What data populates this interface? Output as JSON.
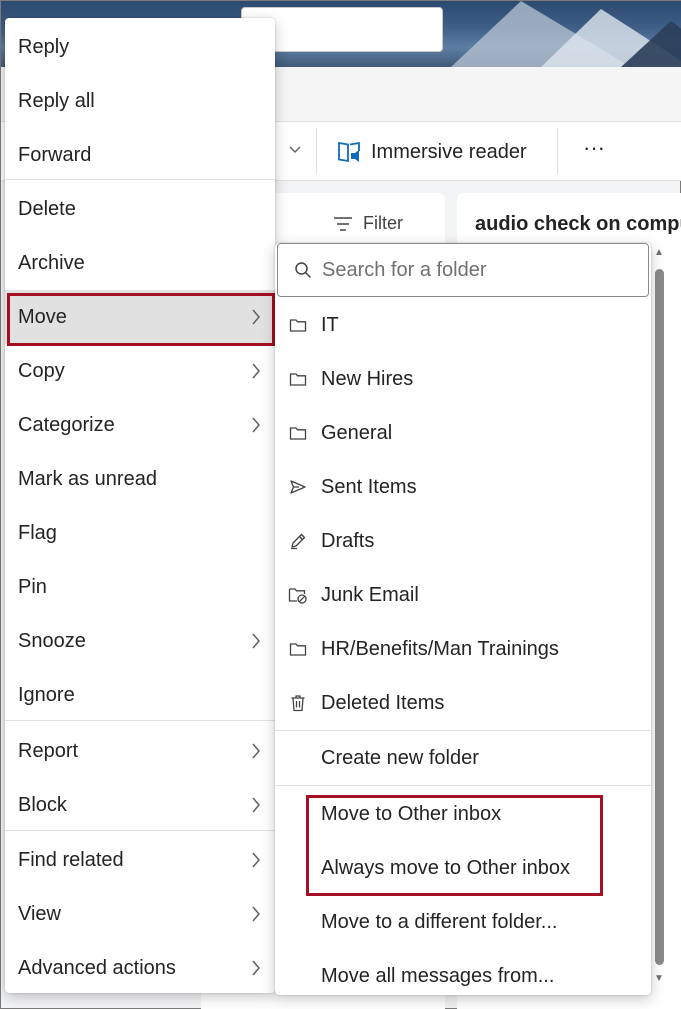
{
  "toolbar": {
    "immersive_reader_label": "Immersive reader",
    "more_label": "···"
  },
  "list_pane": {
    "filter_label": "Filter"
  },
  "reading_pane": {
    "title": "audio check on compu"
  },
  "context_menu": {
    "items": [
      {
        "label": "Reply"
      },
      {
        "label": "Reply all"
      },
      {
        "label": "Forward"
      },
      {
        "label": "Delete"
      },
      {
        "label": "Archive"
      },
      {
        "label": "Move",
        "has_submenu": true,
        "active": true
      },
      {
        "label": "Copy",
        "has_submenu": true
      },
      {
        "label": "Categorize",
        "has_submenu": true
      },
      {
        "label": "Mark as unread"
      },
      {
        "label": "Flag"
      },
      {
        "label": "Pin"
      },
      {
        "label": "Snooze",
        "has_submenu": true
      },
      {
        "label": "Ignore"
      },
      {
        "label": "Report",
        "has_submenu": true
      },
      {
        "label": "Block",
        "has_submenu": true
      },
      {
        "label": "Find related",
        "has_submenu": true
      },
      {
        "label": "View",
        "has_submenu": true
      },
      {
        "label": "Advanced actions",
        "has_submenu": true
      }
    ]
  },
  "move_submenu": {
    "search_placeholder": "Search for a folder",
    "folders": [
      {
        "label": "IT",
        "icon": "folder-icon"
      },
      {
        "label": "New Hires",
        "icon": "folder-icon"
      },
      {
        "label": "General",
        "icon": "folder-icon"
      },
      {
        "label": "Sent Items",
        "icon": "send-icon"
      },
      {
        "label": "Drafts",
        "icon": "pencil-icon"
      },
      {
        "label": "Junk Email",
        "icon": "junk-folder-icon"
      },
      {
        "label": "HR/Benefits/Man Trainings",
        "icon": "folder-icon"
      },
      {
        "label": "Deleted Items",
        "icon": "trash-icon"
      }
    ],
    "actions": [
      {
        "label": "Create new folder"
      },
      {
        "label": "Move to Other inbox"
      },
      {
        "label": "Always move to Other inbox"
      },
      {
        "label": "Move to a different folder..."
      },
      {
        "label": "Move all messages from..."
      }
    ]
  },
  "colors": {
    "highlight_border": "#a50f23",
    "active_item_bg": "#e1e1e1",
    "accent": "#0f6cbd"
  }
}
